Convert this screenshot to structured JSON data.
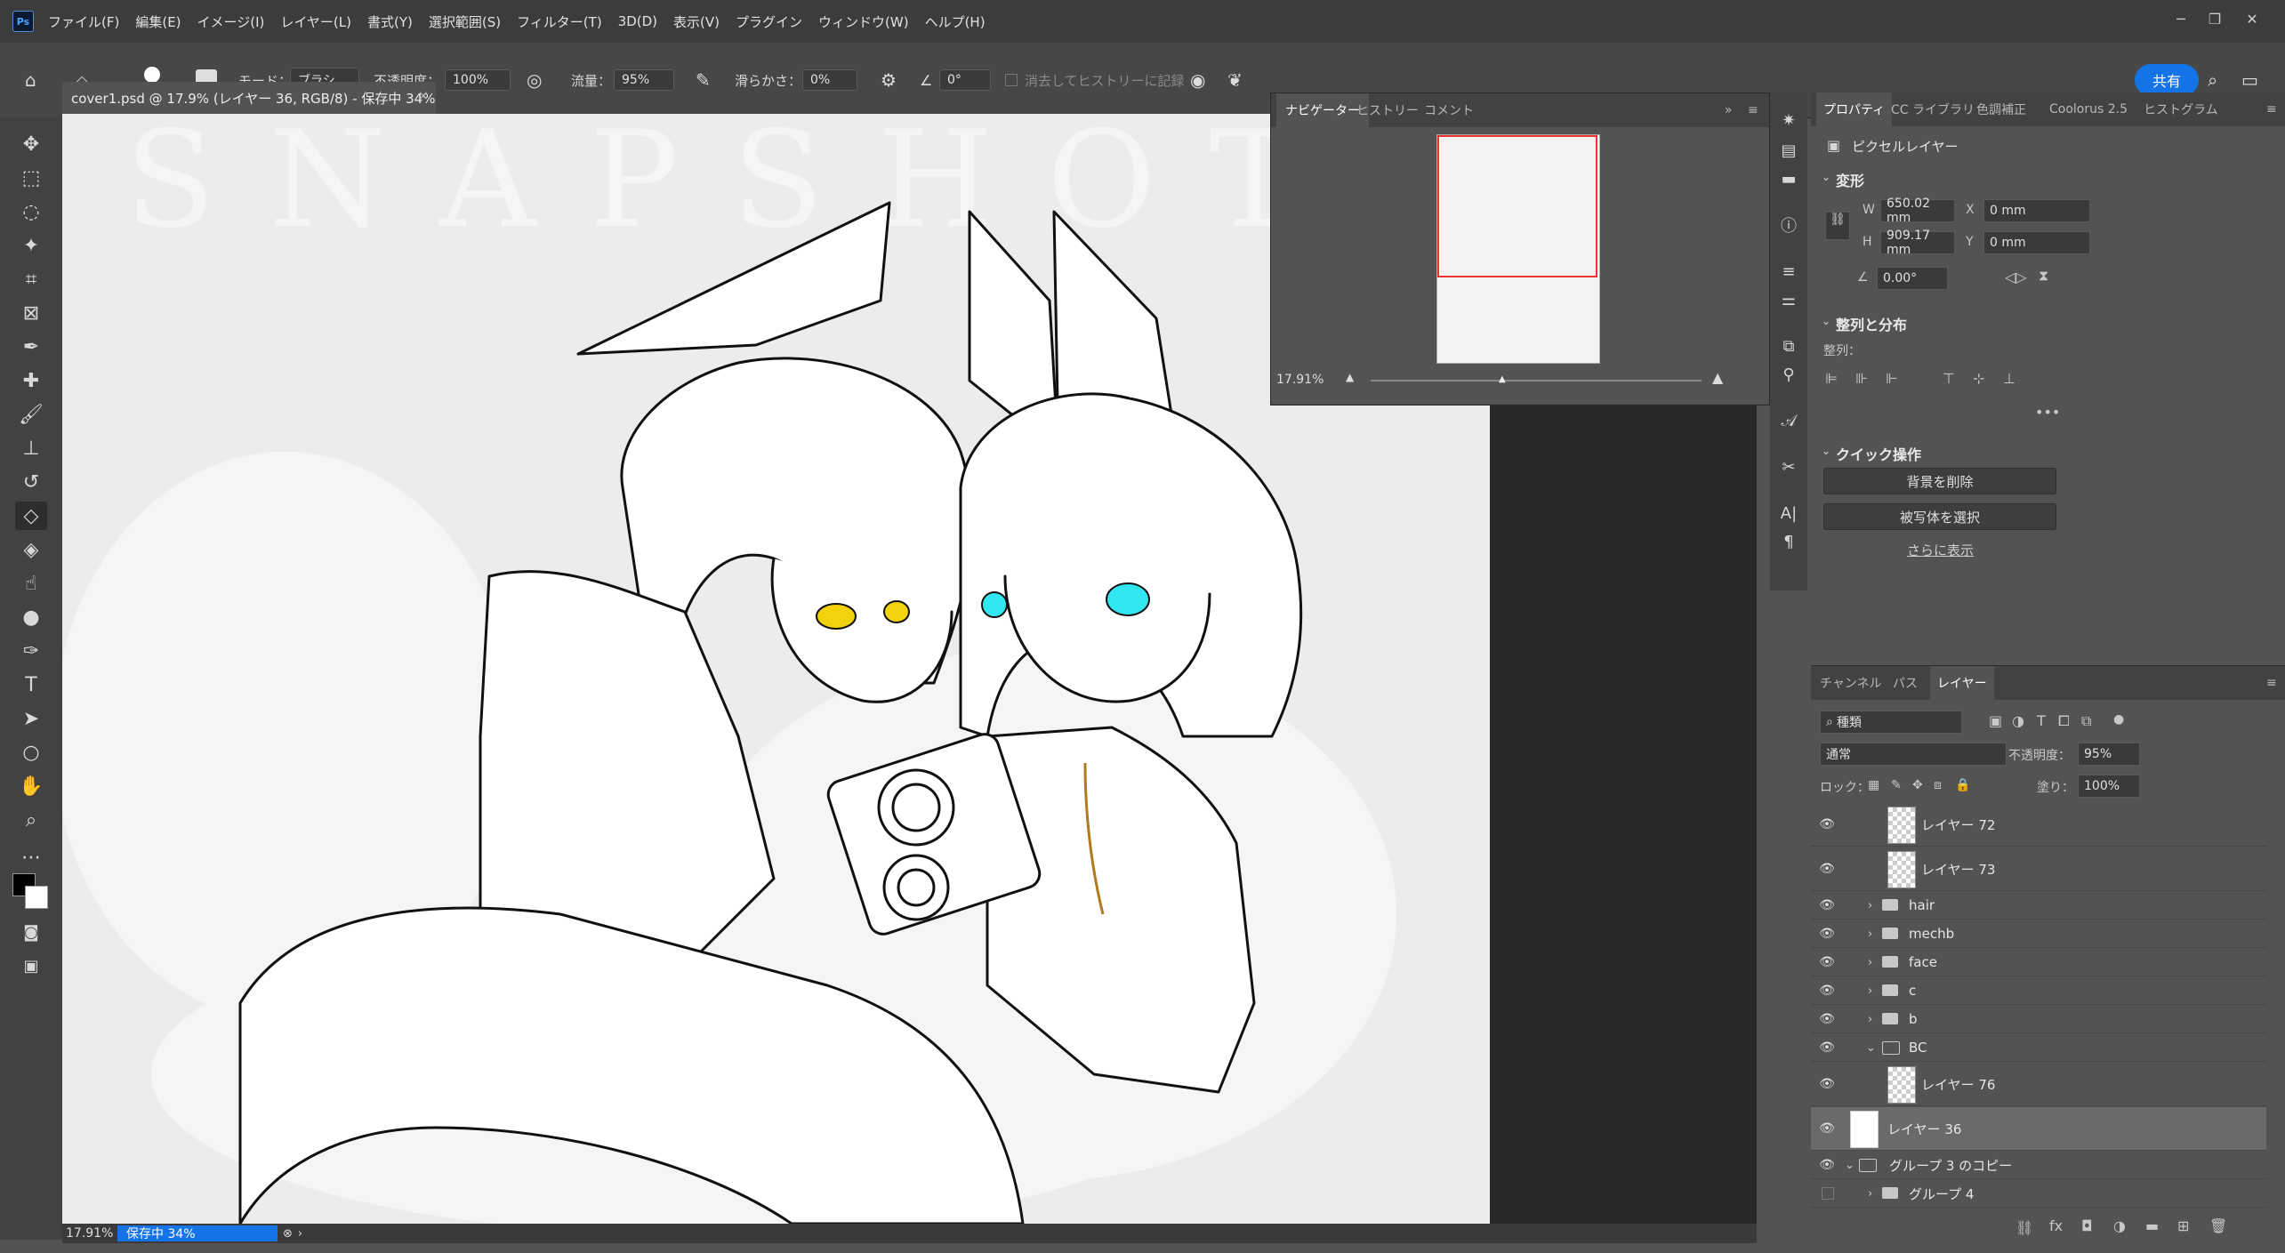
{
  "app": {
    "menu": [
      "ファイル(F)",
      "編集(E)",
      "イメージ(I)",
      "レイヤー(L)",
      "書式(Y)",
      "選択範囲(S)",
      "フィルター(T)",
      "3D(D)",
      "表示(V)",
      "プラグイン",
      "ウィンドウ(W)",
      "ヘルプ(H)"
    ]
  },
  "options": {
    "brush_size": "100",
    "mode_label": "モード：",
    "mode_value": "ブラシ",
    "opacity_label": "不透明度：",
    "opacity_value": "100%",
    "flow_label": "流量：",
    "flow_value": "95%",
    "smoothing_label": "滑らかさ：",
    "smoothing_value": "0%",
    "angle_value": "0°",
    "erase_history_label": "消去してヒストリーに記録",
    "share_label": "共有"
  },
  "document": {
    "tab_title": "cover1.psd @ 17.9% (レイヤー 36, RGB/8) - 保存中 34%",
    "status_zoom": "17.91%",
    "status_saving": "保存中 34%",
    "watermark": "SNAPSHOT"
  },
  "navigator": {
    "tabs": [
      "ナビゲーター",
      "ヒストリー",
      "コメント"
    ],
    "zoom": "17.91%"
  },
  "properties": {
    "tabs": [
      "プロパティ",
      "CC ライブラリ",
      "色調補正",
      "Coolorus 2.5",
      "ヒストグラム"
    ],
    "layer_type": "ピクセルレイヤー",
    "transform_title": "変形",
    "w_label": "W",
    "w_value": "650.02 mm",
    "x_label": "X",
    "x_value": "0 mm",
    "h_label": "H",
    "h_value": "909.17 mm",
    "y_label": "Y",
    "y_value": "0 mm",
    "angle_value": "0.00°",
    "align_title": "整列と分布",
    "align_label": "整列：",
    "quick_title": "クイック操作",
    "remove_bg": "背景を削除",
    "select_subject": "被写体を選択",
    "show_more": "さらに表示"
  },
  "layers": {
    "tabs": [
      "チャンネル",
      "パス",
      "レイヤー"
    ],
    "filter_kind": "種類",
    "blend_mode": "通常",
    "opacity_label": "不透明度：",
    "opacity_value": "95%",
    "lock_label": "ロック：",
    "fill_label": "塗り：",
    "fill_value": "100%",
    "items": [
      {
        "name": "レイヤー 72"
      },
      {
        "name": "レイヤー 73"
      },
      {
        "name": "hair"
      },
      {
        "name": "mechb"
      },
      {
        "name": "face"
      },
      {
        "name": "c"
      },
      {
        "name": "b"
      },
      {
        "name": "BC"
      },
      {
        "name": "レイヤー 76"
      },
      {
        "name": "レイヤー 36"
      },
      {
        "name": "グループ 3 のコピー"
      },
      {
        "name": "グループ 4"
      }
    ]
  }
}
